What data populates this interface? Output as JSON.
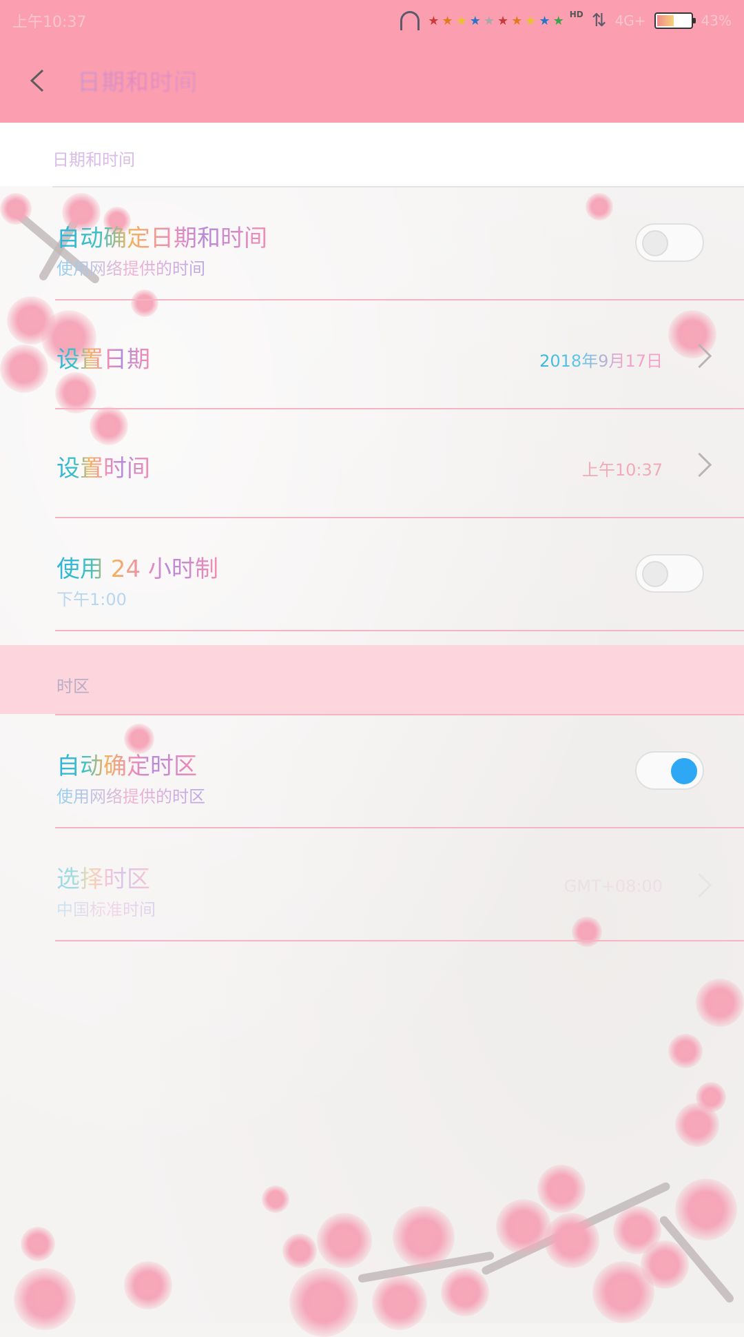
{
  "status_bar": {
    "time": "上午10:37",
    "network": "4G+",
    "battery": "43%",
    "hd": "HD"
  },
  "header": {
    "title": "日期和时间"
  },
  "sections": {
    "date_time_label": "日期和时间",
    "timezone_label": "时区"
  },
  "rows": {
    "auto_datetime": {
      "title": "自动确定日期和时间",
      "subtitle": "使用网络提供的时间",
      "enabled": false
    },
    "set_date": {
      "title": "设置日期",
      "value": "2018年9月17日"
    },
    "set_time": {
      "title": "设置时间",
      "value": "上午10:37"
    },
    "use_24h": {
      "title": "使用 24 小时制",
      "subtitle": "下午1:00",
      "enabled": false
    },
    "auto_timezone": {
      "title": "自动确定时区",
      "subtitle": "使用网络提供的时区",
      "enabled": true
    },
    "select_timezone": {
      "title": "选择时区",
      "subtitle": "中国标准时间",
      "value": "GMT+08:00"
    }
  },
  "colors": {
    "header": "#fb9fb0",
    "section_band": "#fcd5dd",
    "divider": "#f5b3c3",
    "toggle_on": "#2ea8f5"
  },
  "icons": {
    "back": "chevron-left-icon",
    "headset": "headset-icon",
    "signal": "signal-arrows-icon",
    "battery": "battery-icon",
    "chevron": "chevron-right-icon"
  }
}
